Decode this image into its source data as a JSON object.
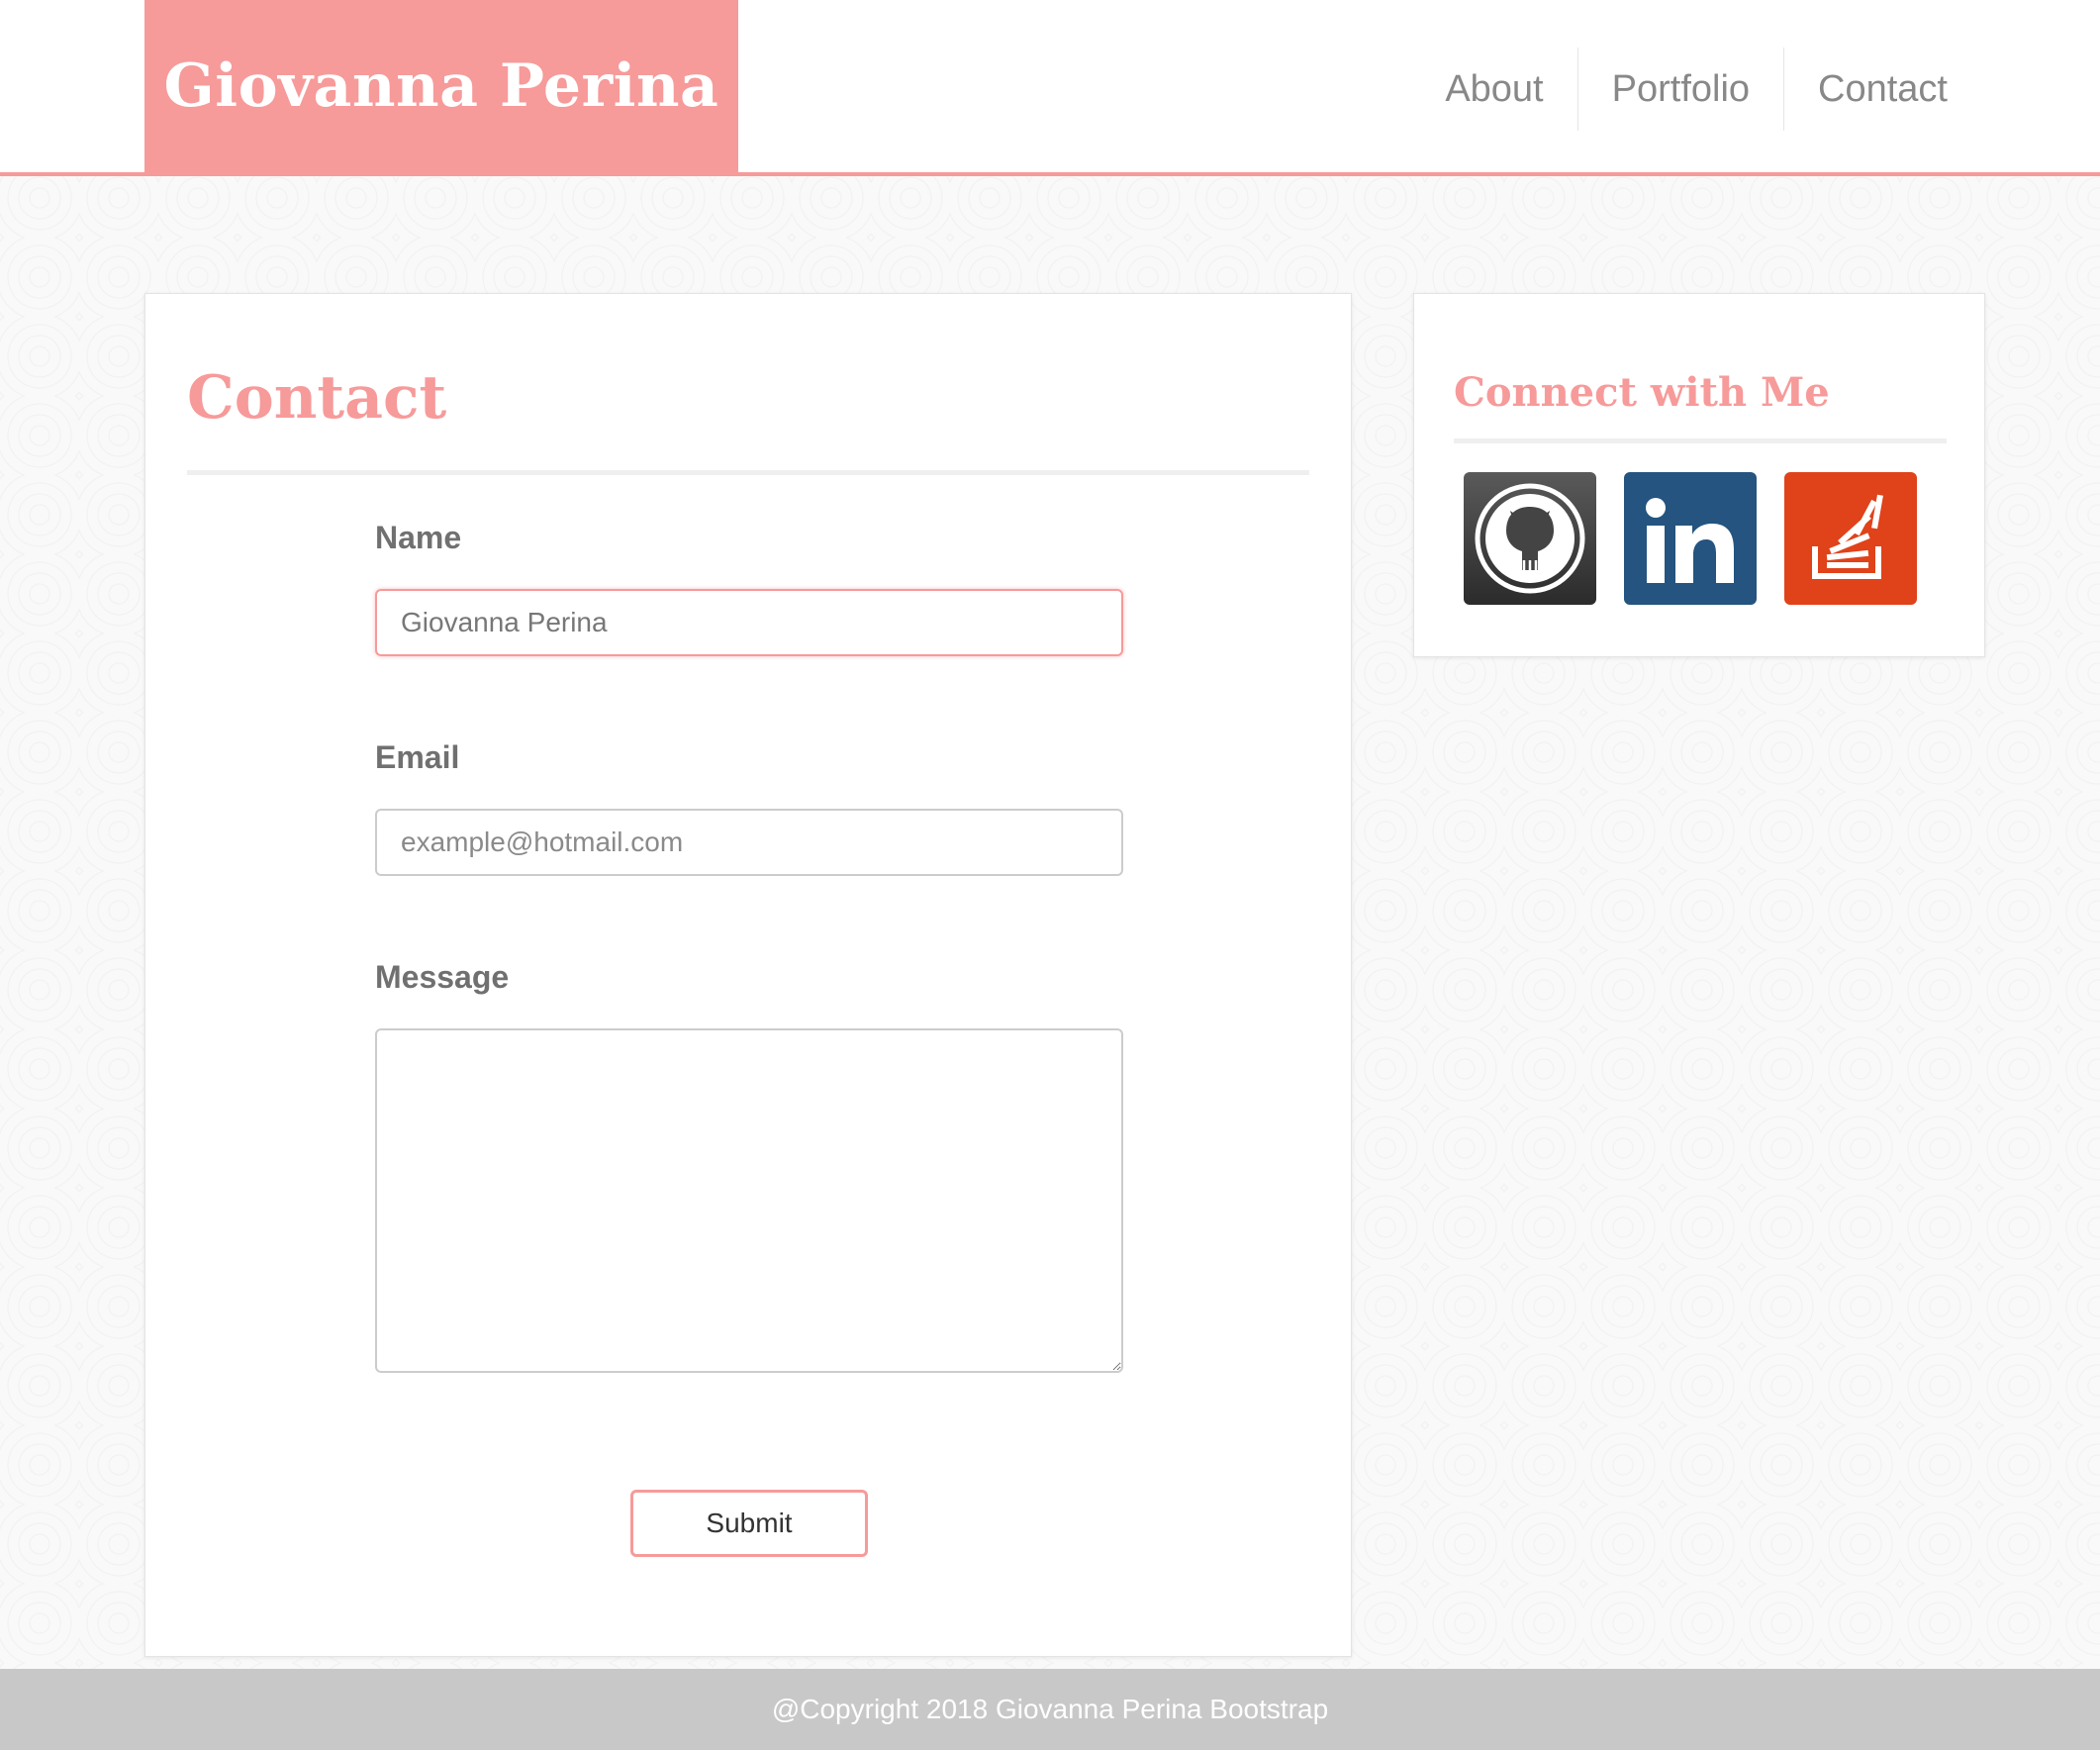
{
  "header": {
    "brand": "Giovanna Perina",
    "nav": [
      "About",
      "Portfolio",
      "Contact"
    ]
  },
  "contact": {
    "title": "Contact",
    "name_label": "Name",
    "name_value": "Giovanna Perina",
    "email_label": "Email",
    "email_placeholder": "example@hotmail.com",
    "message_label": "Message",
    "message_value": "",
    "submit_label": "Submit"
  },
  "side": {
    "title": "Connect with Me",
    "links": [
      {
        "icon": "github-icon",
        "color": "#333333"
      },
      {
        "icon": "linkedin-icon",
        "color": "#24547f"
      },
      {
        "icon": "stackoverflow-icon",
        "color": "#e0421a"
      }
    ]
  },
  "footer": {
    "text": "@Copyright 2018 Giovanna Perina Bootstrap"
  },
  "colors": {
    "accent": "#f79a9a",
    "footer_bg": "#c8c8c8"
  }
}
